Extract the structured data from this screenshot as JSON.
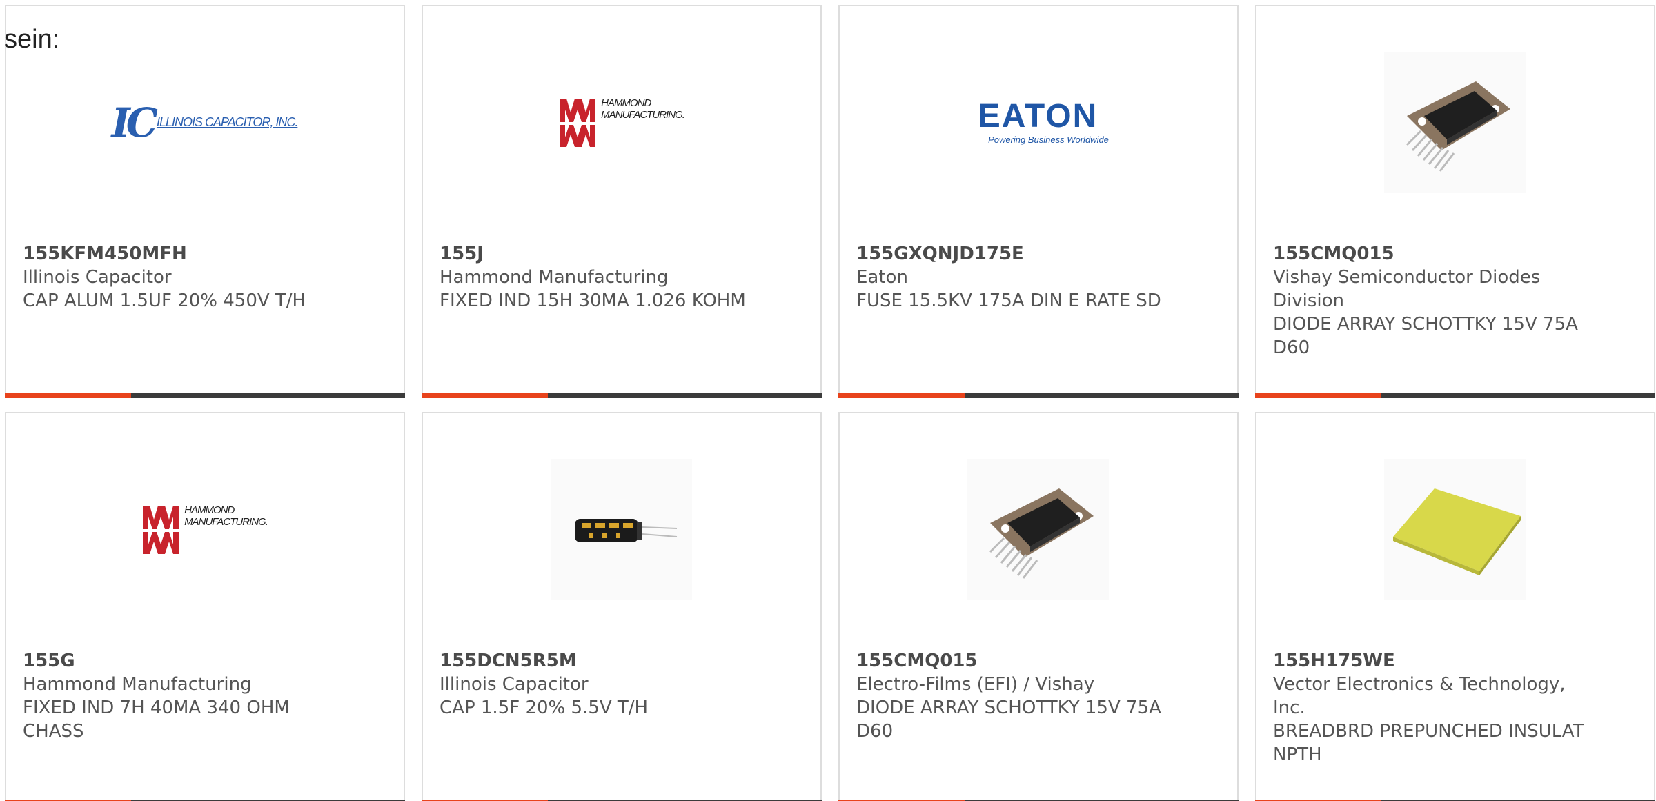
{
  "heading": "sein:",
  "cards": [
    {
      "part_number": "155KFM450MFH",
      "manufacturer": "Illinois Capacitor",
      "description": "CAP ALUM 1.5UF 20% 450V T/H",
      "logo_text": "ILLINOIS CAPACITOR, INC."
    },
    {
      "part_number": "155J",
      "manufacturer": "Hammond Manufacturing",
      "description": "FIXED IND 15H 30MA 1.026 KOHM",
      "logo_text": "HAMMOND\nMANUFACTURING."
    },
    {
      "part_number": "155GXQNJD175E",
      "manufacturer": "Eaton",
      "description": "FUSE 15.5KV 175A DIN E RATE SD",
      "logo_text": "EATON",
      "logo_tagline": "Powering Business Worldwide"
    },
    {
      "part_number": "155CMQ015",
      "manufacturer": "Vishay Semiconductor Diodes Division",
      "description": "DIODE ARRAY SCHOTTKY 15V 75A D60"
    },
    {
      "part_number": "155G",
      "manufacturer": "Hammond Manufacturing",
      "description": "FIXED IND 7H 40MA 340 OHM CHASS",
      "logo_text": "HAMMOND\nMANUFACTURING."
    },
    {
      "part_number": "155DCN5R5M",
      "manufacturer": "Illinois Capacitor",
      "description": "CAP 1.5F 20% 5.5V T/H"
    },
    {
      "part_number": "155CMQ015",
      "manufacturer": "Electro-Films (EFI) / Vishay",
      "description": "DIODE ARRAY SCHOTTKY 15V 75A D60"
    },
    {
      "part_number": "155H175WE",
      "manufacturer": "Vector Electronics & Technology, Inc.",
      "description": "BREADBRD PREPUNCHED INSULAT NPTH"
    }
  ],
  "colors": {
    "accent_bar": "#e8431c",
    "bar": "#3b3b3b",
    "card_border": "#dddddd",
    "text": "#555555"
  },
  "icons": {
    "ic_logo": "illinois-capacitor-logo",
    "hammond_logo": "hammond-logo",
    "eaton_logo": "eaton-logo",
    "chip_photo": "diode-array-chip-photo",
    "capacitor_photo": "capacitor-photo",
    "breadboard_photo": "breadboard-photo"
  }
}
